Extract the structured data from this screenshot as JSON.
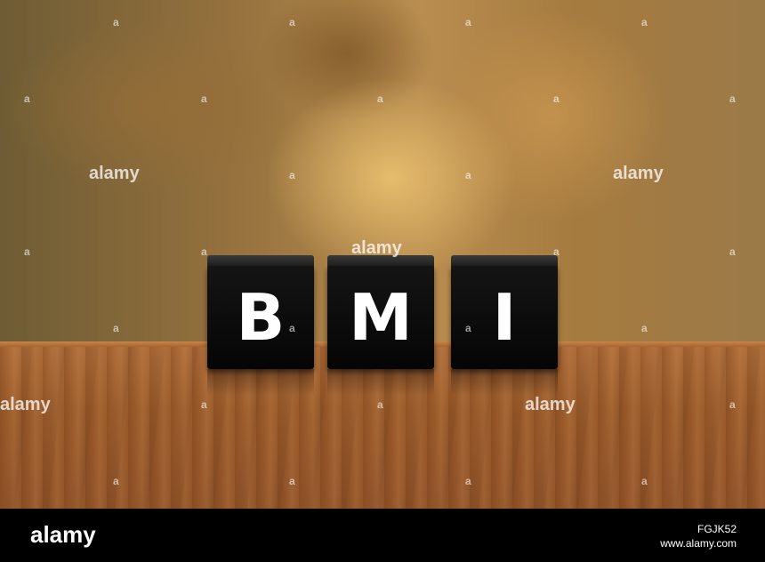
{
  "photo": {
    "blocks": [
      {
        "letter": "B"
      },
      {
        "letter": "M"
      },
      {
        "letter": "I"
      }
    ],
    "watermark_text": "alamy",
    "watermark_mark": "a"
  },
  "footer": {
    "brand": "alamy",
    "image_code": "FGJK52",
    "site": "www.alamy.com"
  }
}
